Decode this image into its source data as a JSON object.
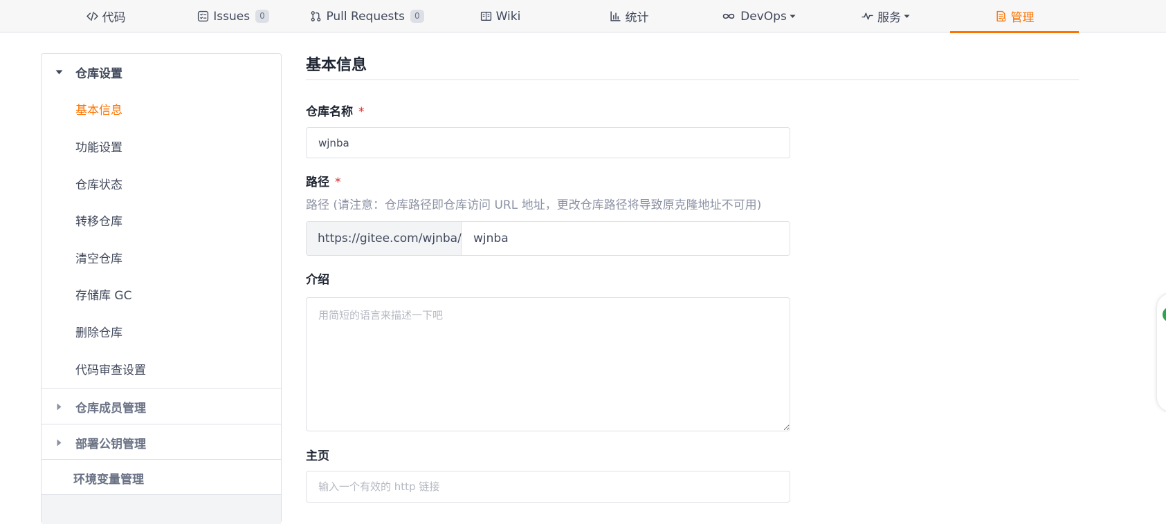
{
  "nav": {
    "tabs": [
      {
        "label": "代码",
        "icon": "code-icon"
      },
      {
        "label": "Issues",
        "badge": "0",
        "icon": "issues-icon"
      },
      {
        "label": "Pull Requests",
        "badge": "0",
        "icon": "pull-request-icon"
      },
      {
        "label": "Wiki",
        "icon": "wiki-icon"
      },
      {
        "label": "统计",
        "icon": "chart-icon"
      },
      {
        "label": "DevOps",
        "icon": "infinity-icon"
      },
      {
        "label": "服务",
        "icon": "pulse-icon"
      },
      {
        "label": "管理",
        "icon": "manage-icon",
        "active": true
      }
    ],
    "accent_color": "#fe7300"
  },
  "sidebar": {
    "group_repo": "仓库设置",
    "items": [
      "基本信息",
      "功能设置",
      "仓库状态",
      "转移仓库",
      "清空仓库",
      "存储库 GC",
      "删除仓库",
      "代码审查设置"
    ],
    "active_item": "基本信息",
    "group_members": "仓库成员管理",
    "group_deploy_keys": "部署公钥管理",
    "group_env": "环境变量管理"
  },
  "form": {
    "title": "基本信息",
    "name_label": "仓库名称",
    "required_mark": "*",
    "name_value": "wjnba",
    "path_label": "路径",
    "path_hint": "路径 (请注意：仓库路径即仓库访问 URL 地址，更改仓库路径将导致原克隆地址不可用)",
    "path_prefix": "https://gitee.com/wjnba/",
    "path_value": "wjnba",
    "intro_label": "介绍",
    "intro_placeholder": "用简短的语言来描述一下吧",
    "homepage_label": "主页",
    "homepage_placeholder": "输入一个有效的 http 链接"
  }
}
